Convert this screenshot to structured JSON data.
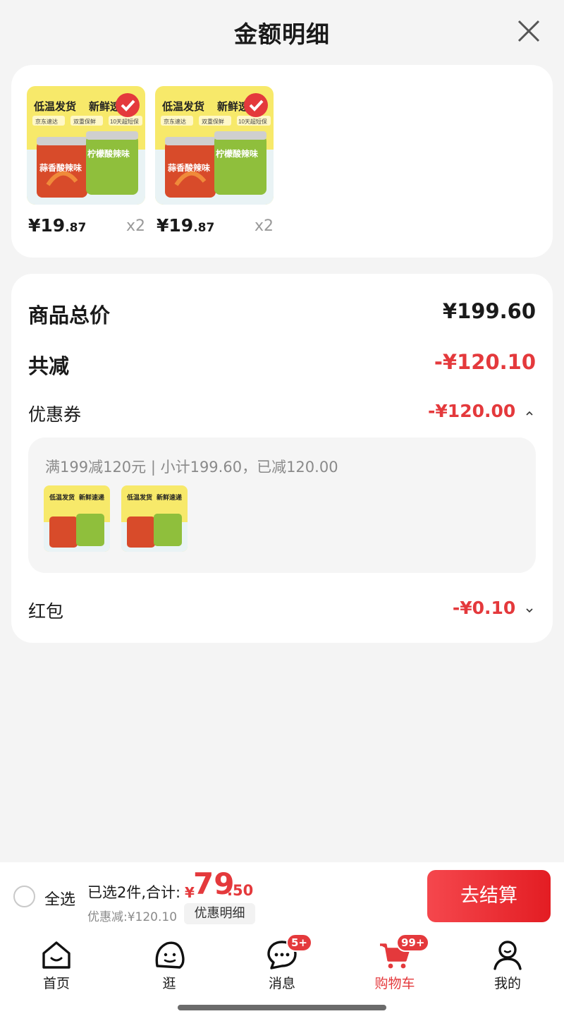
{
  "header": {
    "title": "金额明细",
    "close_icon": "close-icon"
  },
  "products": [
    {
      "price_int": "¥19",
      "price_dec": ".87",
      "qty": "x2",
      "image_text": [
        "低温发货",
        "新鲜速",
        "京东速达",
        "双重保鲜",
        "10天超短保",
        "蒜香酸辣味",
        "柠檬酸辣味"
      ]
    },
    {
      "price_int": "¥19",
      "price_dec": ".87",
      "qty": "x2",
      "image_text": [
        "低温发货",
        "新鲜速",
        "京东速达",
        "双重保鲜",
        "10天超短保",
        "蒜香酸辣味",
        "柠檬酸辣味"
      ]
    }
  ],
  "summary": {
    "total_label": "商品总价",
    "total_value": "¥199.60",
    "reduce_label": "共减",
    "reduce_value": "-¥120.10",
    "coupon_label": "优惠券",
    "coupon_value": "-¥120.00",
    "coupon_desc": "满199减120元 | 小计199.60，已减120.00",
    "redpack_label": "红包",
    "redpack_value": "-¥0.10"
  },
  "mini_image_text": [
    "低温发货",
    "新鲜速递"
  ],
  "bottom_bar": {
    "select_all": "全选",
    "selected_text": "已选2件,合计:",
    "currency": "¥",
    "total_int": "79",
    "total_dec": ".50",
    "discount_text": "优惠减:¥120.10",
    "detail_button": "优惠明细",
    "checkout_button": "去结算"
  },
  "tabs": [
    {
      "label": "首页",
      "icon": "home-icon"
    },
    {
      "label": "逛",
      "icon": "explore-icon"
    },
    {
      "label": "消息",
      "icon": "message-icon",
      "badge": "5+"
    },
    {
      "label": "购物车",
      "icon": "cart-icon",
      "badge": "99+",
      "active": true
    },
    {
      "label": "我的",
      "icon": "profile-icon"
    }
  ],
  "colors": {
    "accent": "#e4393c",
    "background": "#f4f4f4",
    "muted": "#8a8a8a"
  }
}
